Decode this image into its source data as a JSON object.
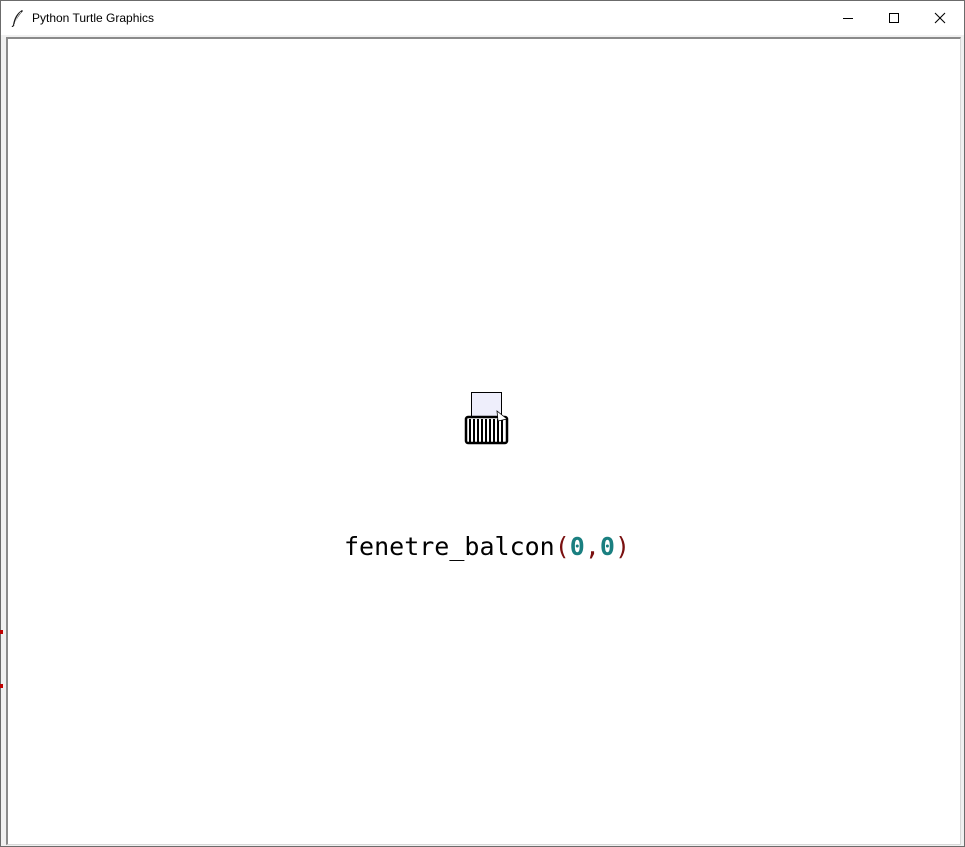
{
  "window": {
    "title": "Python Turtle Graphics",
    "icon": "feather-icon",
    "controls": [
      "minimize-icon",
      "maximize-icon",
      "close-icon"
    ]
  },
  "canvas": {
    "background": "#ffffff",
    "drawing": {
      "window_fill": "#eeeefb",
      "stroke_color": "#000000",
      "cursor": "turtle-arrow-icon"
    },
    "caption": {
      "function": "fenetre_balcon",
      "open_paren": "(",
      "arg1": "0",
      "comma": ",",
      "arg2": "0",
      "close_paren": ")",
      "colors": {
        "function": "#000000",
        "paren": "#7a1010",
        "number": "#1a7f80",
        "comma": "#7a1010"
      }
    }
  }
}
